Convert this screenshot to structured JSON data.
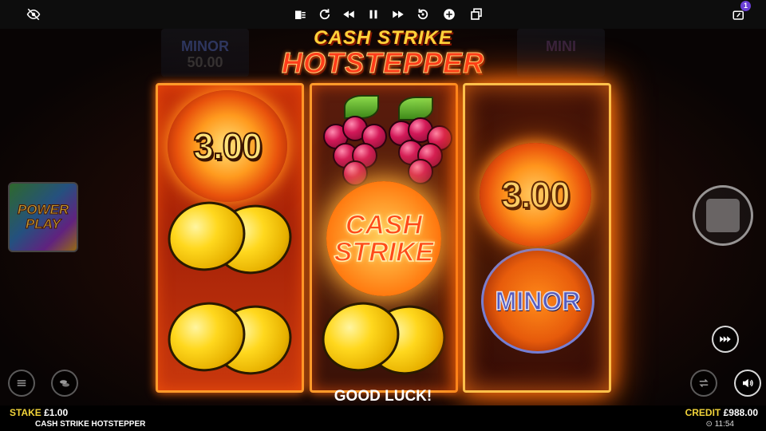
{
  "top_bar": {
    "icons": [
      "eye-off-icon",
      "clear-icon",
      "reload-icon",
      "rewind-icon",
      "pause-icon",
      "fast-forward-icon",
      "replay-icon",
      "add-icon",
      "copy-icon",
      "dashboard-icon"
    ],
    "notification_count": "1"
  },
  "jackpots": {
    "left_label": "MINOR",
    "left_value": "50.00",
    "right_label": "MINI"
  },
  "logo": {
    "line1": "CASH STRIKE",
    "line2": "HOTSTEPPER"
  },
  "reels": {
    "reel1": {
      "sun_value": "3.00",
      "symbols": [
        "sun-coin",
        "lemon",
        "lemon"
      ]
    },
    "reel2": {
      "symbols": [
        "cherries",
        "cash-strike",
        "lemon"
      ],
      "cash_strike_line1": "CASH",
      "cash_strike_line2": "STRIKE"
    },
    "reel3": {
      "sun_value": "3.00",
      "jackpot_label": "MINOR",
      "symbols": [
        "sun-coin",
        "minor-coin"
      ]
    }
  },
  "power_play": {
    "line1": "POWER",
    "line2": "PLAY"
  },
  "message": "GOOD LUCK!",
  "bottom": {
    "stake_label": "STAKE",
    "stake_value": "£1.00",
    "credit_label": "CREDIT",
    "credit_value": "£988.00",
    "game_name": "CASH STRIKE HOTSTEPPER",
    "clock": "11:54"
  },
  "colors": {
    "accent": "#f2d43a",
    "reel_border": "#ff9a2a",
    "notification": "#6b3fd6"
  }
}
